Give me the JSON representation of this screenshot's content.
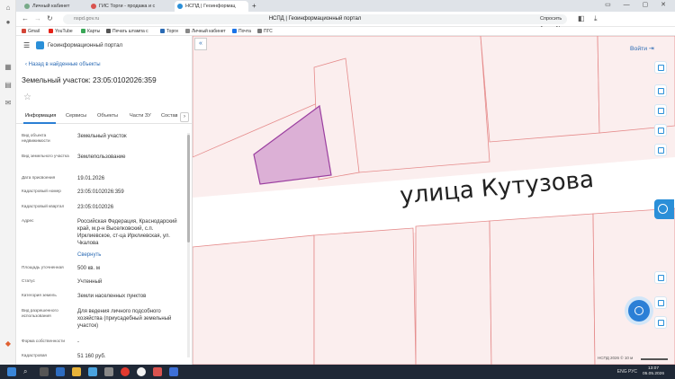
{
  "browser": {
    "tabs": [
      {
        "label": "Личный кабинет",
        "active": false
      },
      {
        "label": "ГИС Торги - продажа и с",
        "active": false
      },
      {
        "label": "НСПД | Геоинформац",
        "active": true
      }
    ],
    "url_host": "nspd.gov.ru",
    "page_title": "НСПД | Геоинформационный портал",
    "assistant_button": "Спросить Алису AI",
    "bookmarks": [
      "Gmail",
      "YouTube",
      "Карты",
      "Печать штампа с",
      "Торги",
      "Личный кабинет",
      "Почта",
      "ПГС"
    ],
    "bookmark_colors": [
      "#d44638",
      "#e62117",
      "#3aa757",
      "#555555",
      "#2a6ab4",
      "#888888",
      "#1a73e8",
      "#777777"
    ]
  },
  "panel": {
    "portal_name": "Геоинформационный портал",
    "back_link": "Назад в найденные объекты",
    "title": "Земельный участок: 23:05:0102026:359",
    "tabs": [
      "Информация",
      "Сервисы",
      "Объекты",
      "Части ЗУ",
      "Состав"
    ],
    "fields": [
      {
        "label": "Вид объекта недвижимости",
        "value": "Земельный участок"
      },
      {
        "label": "Вид земельного участка",
        "value": "Землепользование"
      },
      {
        "label": "Дата присвоения",
        "value": "19.01.2026"
      },
      {
        "label": "Кадастровый номер",
        "value": "23:05:0102026:359"
      },
      {
        "label": "Кадастровый квартал",
        "value": "23:05:0102026"
      },
      {
        "label": "Адрес",
        "value": "Российская Федерация, Краснодарский край, м.р-н Выселковский, с.п. Ирклиевское, ст-ца Ирклиевская, ул. Чкалова"
      },
      {
        "label": "Площадь уточненная",
        "value": "500 кв. м"
      },
      {
        "label": "Статус",
        "value": "Учтенный"
      },
      {
        "label": "Категория земель",
        "value": "Земли населенных пунктов"
      },
      {
        "label": "Вид разрешенного использования",
        "value": "Для ведения личного подсобного хозяйства (приусадебный земельный участок)"
      },
      {
        "label": "Форма собственности",
        "value": "-"
      },
      {
        "label": "Кадастровая",
        "value": "51 160 руб."
      }
    ],
    "expand_link": "Свернуть"
  },
  "map": {
    "street_label": "улица Кутузова",
    "login": "Войти",
    "copyright": "НСПД 2026 ©",
    "scale": "10 м",
    "colors": {
      "parcel_fill": "#fbeeee",
      "parcel_border": "#e58a8a",
      "selected_fill": "#dcb0d6",
      "selected_border": "#9b3fa0",
      "water": "#6aaee6",
      "road": "#ffffff"
    }
  },
  "taskbar": {
    "tray": "ENG",
    "lang": "РУС",
    "time": "13:07",
    "date": "05.05.2026"
  }
}
